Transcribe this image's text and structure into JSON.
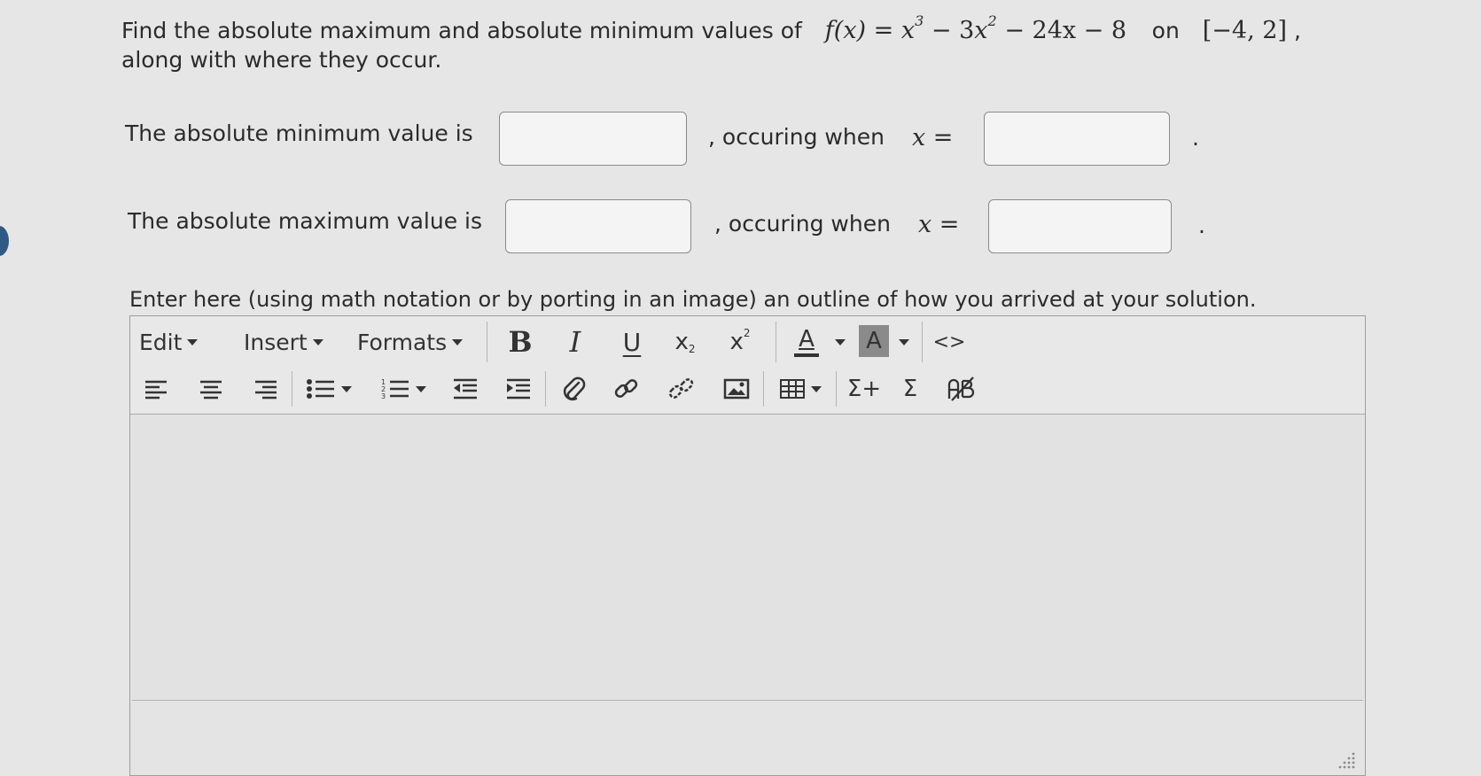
{
  "question": {
    "line1_text": "Find the absolute maximum and absolute minimum values of",
    "function_lhs": "f(x) =",
    "function_rhs_x": "x",
    "function_rhs_exp3": "3",
    "function_rhs_mid": "− 3",
    "function_rhs_x2": "x",
    "function_rhs_exp2": "2",
    "function_rhs_tail": "− 24x − 8",
    "on_word": "on",
    "interval": "[−4, 2]",
    "comma": ",",
    "line2_text": "along with where they occur."
  },
  "minimum_row": {
    "label": "The absolute minimum value is",
    "occurs_text": ", occuring when",
    "x_eq": "x =",
    "period": ".",
    "value_answer": "",
    "x_answer": ""
  },
  "maximum_row": {
    "label": "The absolute maximum value is",
    "occurs_text": ", occuring when",
    "x_eq": "x =",
    "period": ".",
    "value_answer": "",
    "x_answer": ""
  },
  "instruction": "Enter here (using math notation or by porting in an image) an outline of how you arrived at your solution.",
  "toolbar": {
    "edit_label": "Edit",
    "insert_label": "Insert",
    "formats_label": "Formats",
    "bold_label": "B",
    "italic_label": "I",
    "underline_label": "U",
    "subscript_label": "x",
    "subscript_mark": "2",
    "superscript_label": "x",
    "superscript_mark": "2",
    "font_color_label": "A",
    "bg_color_label": "A",
    "code_label": "<>",
    "sum_plus_label": "Σ+",
    "sum_label": "Σ"
  },
  "editor": {
    "content": ""
  },
  "colors": {
    "page_bg": "#e6e6e6",
    "text": "#2b2b2b",
    "highlight_swatch": "#8a8a8a",
    "marker": "#2f5a86"
  },
  "icons": [
    "align-left-icon",
    "align-center-icon",
    "align-right-icon",
    "bullet-list-icon",
    "numbered-list-icon",
    "outdent-icon",
    "indent-icon",
    "attachment-icon",
    "link-icon",
    "unlink-icon",
    "image-icon",
    "table-icon",
    "sum-plus-icon",
    "sum-icon",
    "spellcheck-icon",
    "resize-handle-icon"
  ]
}
